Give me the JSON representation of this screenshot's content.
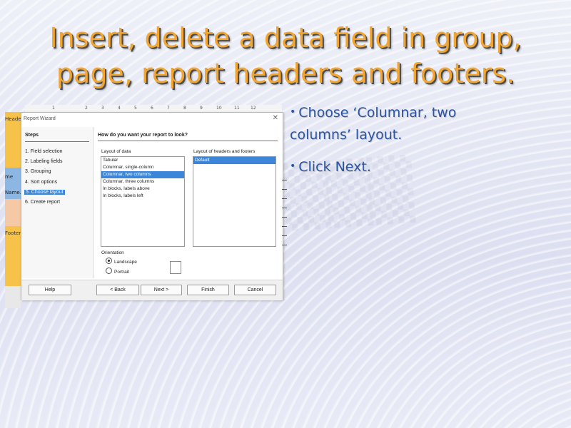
{
  "slide": {
    "title_line1": "Insert, delete a data field in group,",
    "title_line2": "page, report headers and footers.",
    "bullets": [
      {
        "text_line1": "Choose ‘Columnar, two",
        "text_line2": "columns’ layout."
      },
      {
        "text_line1": "Click Next.",
        "text_line2": ""
      }
    ]
  },
  "ruler": {
    "marks": [
      "1",
      "2",
      "3",
      "4",
      "5",
      "6",
      "7",
      "8",
      "9",
      "10",
      "11",
      "12"
    ]
  },
  "report_sections": {
    "header": "Header",
    "group1": "me H...",
    "group2": "Name...",
    "footer": "Footer"
  },
  "dialog": {
    "title": "Report Wizard",
    "close": "✕",
    "steps_heading": "Steps",
    "steps": [
      {
        "label": "1. Field selection"
      },
      {
        "label": "2. Labeling fields"
      },
      {
        "label": "3. Grouping"
      },
      {
        "label": "4. Sort options"
      },
      {
        "label": "5. Choose layout",
        "active": true
      },
      {
        "label": "6. Create report"
      }
    ],
    "question": "How do you want your report to look?",
    "data_layout_label": "Layout of data",
    "data_layout_options": [
      {
        "label": "Tabular"
      },
      {
        "label": "Columnar, single-column"
      },
      {
        "label": "Columnar, two columns",
        "selected": true
      },
      {
        "label": "Columnar, three columns"
      },
      {
        "label": "In blocks, labels above"
      },
      {
        "label": "In blocks, labels left"
      }
    ],
    "header_layout_label": "Layout of headers and footers",
    "header_layout_options": [
      {
        "label": "Default",
        "selected": true
      }
    ],
    "orientation_label": "Orientation",
    "orientation_options": [
      {
        "label": "Landscape",
        "checked": true
      },
      {
        "label": "Portrait",
        "checked": false
      }
    ],
    "buttons": {
      "help": "Help",
      "back": "< Back",
      "next": "Next >",
      "finish": "Finish",
      "cancel": "Cancel"
    }
  },
  "colors": {
    "title": "#f3a531",
    "bullet": "#2b55a3",
    "selection": "#3b86d8"
  }
}
